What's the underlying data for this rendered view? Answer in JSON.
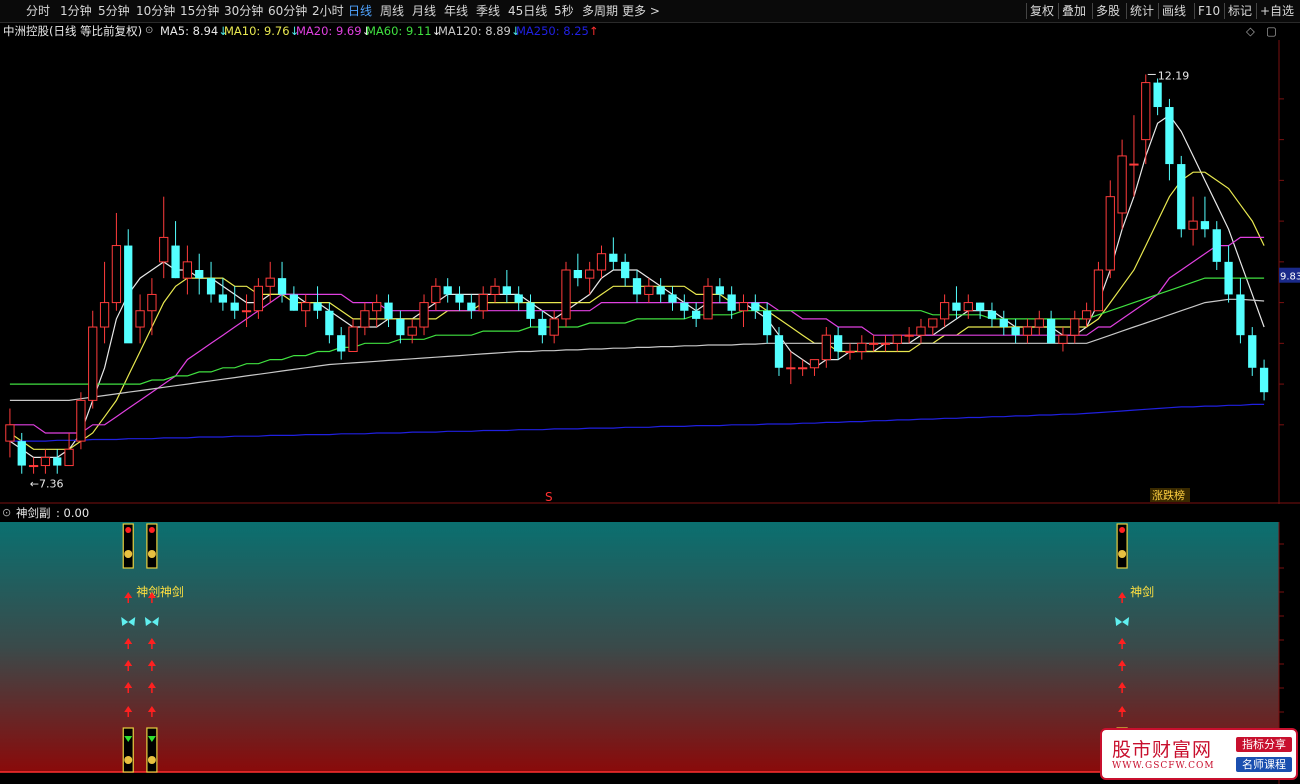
{
  "toolbar": {
    "periods": [
      "分时",
      "1分钟",
      "5分钟",
      "10分钟",
      "15分钟",
      "30分钟",
      "60分钟",
      "2小时",
      "日线",
      "周线",
      "月线",
      "年线",
      "季线",
      "45日线",
      "5秒",
      "多周期",
      "更多 >"
    ],
    "active": "日线",
    "tools": [
      "复权",
      "叠加",
      "多股",
      "统计",
      "画线",
      "F10",
      "标记",
      "+自选"
    ]
  },
  "info": {
    "title": "中洲控股(日线 等比前复权)",
    "ma": [
      {
        "label": "MA5: 8.94",
        "arrow": "↓",
        "color": "#e8e8e8",
        "arrow_color": "#4fe8e8"
      },
      {
        "label": "MA10: 9.76",
        "arrow": "↓",
        "color": "#e8e850",
        "arrow_color": "#4fe8e8"
      },
      {
        "label": "MA20: 9.69",
        "arrow": "↓",
        "color": "#e040e0",
        "arrow_color": "#e8e8e8"
      },
      {
        "label": "MA60: 9.11",
        "arrow": "↓",
        "color": "#40e040",
        "arrow_color": "#e8e8e8"
      },
      {
        "label": "MA120: 8.89",
        "arrow": "↓",
        "color": "#c8c8c8",
        "arrow_color": "#4fe8e8"
      },
      {
        "label": "MA250: 8.25",
        "arrow": "↑",
        "color": "#2020e0",
        "arrow_color": "#ff3030"
      }
    ]
  },
  "chart_data": {
    "type": "candlestick",
    "high_label": "12.19",
    "low_label": "7.36",
    "last_price": "9.83",
    "marker_s": "S",
    "badge": "涨跌榜",
    "up_color": "#ff3c3c",
    "down_color": "#54ffff",
    "ohlc": [
      [
        7.8,
        8.2,
        7.6,
        8.0
      ],
      [
        7.8,
        7.9,
        7.4,
        7.5
      ],
      [
        7.5,
        7.6,
        7.4,
        7.5
      ],
      [
        7.5,
        7.7,
        7.4,
        7.6
      ],
      [
        7.6,
        7.7,
        7.4,
        7.5
      ],
      [
        7.5,
        7.9,
        7.5,
        7.7
      ],
      [
        7.8,
        8.4,
        7.7,
        8.3
      ],
      [
        8.3,
        9.4,
        8.2,
        9.2
      ],
      [
        9.2,
        10.0,
        9.0,
        9.5
      ],
      [
        9.5,
        10.6,
        9.4,
        10.2
      ],
      [
        10.2,
        10.4,
        9.2,
        9.0
      ],
      [
        9.2,
        9.6,
        9.0,
        9.4
      ],
      [
        9.4,
        9.8,
        9.1,
        9.6
      ],
      [
        10.0,
        10.8,
        9.8,
        10.3
      ],
      [
        10.2,
        10.5,
        9.8,
        9.8
      ],
      [
        9.8,
        10.2,
        9.6,
        10.0
      ],
      [
        9.9,
        10.1,
        9.6,
        9.8
      ],
      [
        9.8,
        10.0,
        9.5,
        9.6
      ],
      [
        9.6,
        9.8,
        9.4,
        9.5
      ],
      [
        9.5,
        9.7,
        9.3,
        9.4
      ],
      [
        9.4,
        9.6,
        9.2,
        9.4
      ],
      [
        9.4,
        9.8,
        9.3,
        9.7
      ],
      [
        9.7,
        10.0,
        9.5,
        9.8
      ],
      [
        9.8,
        10.0,
        9.5,
        9.6
      ],
      [
        9.6,
        9.7,
        9.4,
        9.4
      ],
      [
        9.4,
        9.6,
        9.2,
        9.5
      ],
      [
        9.5,
        9.7,
        9.3,
        9.4
      ],
      [
        9.4,
        9.5,
        9.0,
        9.1
      ],
      [
        9.1,
        9.2,
        8.8,
        8.9
      ],
      [
        8.9,
        9.3,
        8.9,
        9.2
      ],
      [
        9.2,
        9.5,
        9.1,
        9.4
      ],
      [
        9.4,
        9.6,
        9.2,
        9.5
      ],
      [
        9.5,
        9.6,
        9.2,
        9.3
      ],
      [
        9.3,
        9.4,
        9.0,
        9.1
      ],
      [
        9.1,
        9.3,
        9.0,
        9.2
      ],
      [
        9.2,
        9.6,
        9.1,
        9.5
      ],
      [
        9.5,
        9.8,
        9.4,
        9.7
      ],
      [
        9.7,
        9.8,
        9.5,
        9.6
      ],
      [
        9.6,
        9.7,
        9.4,
        9.5
      ],
      [
        9.5,
        9.6,
        9.3,
        9.4
      ],
      [
        9.4,
        9.7,
        9.3,
        9.6
      ],
      [
        9.6,
        9.8,
        9.5,
        9.7
      ],
      [
        9.7,
        9.9,
        9.5,
        9.6
      ],
      [
        9.6,
        9.7,
        9.4,
        9.5
      ],
      [
        9.5,
        9.6,
        9.2,
        9.3
      ],
      [
        9.3,
        9.4,
        9.0,
        9.1
      ],
      [
        9.1,
        9.4,
        9.0,
        9.3
      ],
      [
        9.3,
        10.0,
        9.2,
        9.9
      ],
      [
        9.9,
        10.1,
        9.7,
        9.8
      ],
      [
        9.8,
        10.0,
        9.6,
        9.9
      ],
      [
        9.9,
        10.2,
        9.8,
        10.1
      ],
      [
        10.1,
        10.3,
        9.9,
        10.0
      ],
      [
        10.0,
        10.1,
        9.7,
        9.8
      ],
      [
        9.8,
        9.9,
        9.5,
        9.6
      ],
      [
        9.6,
        9.8,
        9.5,
        9.7
      ],
      [
        9.7,
        9.8,
        9.5,
        9.6
      ],
      [
        9.6,
        9.7,
        9.4,
        9.5
      ],
      [
        9.5,
        9.6,
        9.3,
        9.4
      ],
      [
        9.4,
        9.5,
        9.2,
        9.3
      ],
      [
        9.3,
        9.8,
        9.3,
        9.7
      ],
      [
        9.7,
        9.8,
        9.5,
        9.6
      ],
      [
        9.6,
        9.7,
        9.3,
        9.4
      ],
      [
        9.4,
        9.6,
        9.2,
        9.5
      ],
      [
        9.5,
        9.6,
        9.3,
        9.4
      ],
      [
        9.4,
        9.5,
        9.0,
        9.1
      ],
      [
        9.1,
        9.2,
        8.6,
        8.7
      ],
      [
        8.7,
        8.9,
        8.5,
        8.7
      ],
      [
        8.7,
        8.8,
        8.6,
        8.7
      ],
      [
        8.7,
        8.8,
        8.6,
        8.8
      ],
      [
        8.8,
        9.2,
        8.7,
        9.1
      ],
      [
        9.1,
        9.2,
        8.8,
        8.9
      ],
      [
        8.9,
        9.0,
        8.8,
        8.9
      ],
      [
        8.9,
        9.1,
        8.8,
        9.0
      ],
      [
        9.0,
        9.1,
        8.9,
        9.0
      ],
      [
        9.0,
        9.1,
        8.9,
        9.0
      ],
      [
        9.0,
        9.1,
        8.9,
        9.1
      ],
      [
        9.1,
        9.2,
        9.0,
        9.1
      ],
      [
        9.1,
        9.3,
        9.0,
        9.2
      ],
      [
        9.2,
        9.3,
        9.1,
        9.3
      ],
      [
        9.3,
        9.6,
        9.2,
        9.5
      ],
      [
        9.5,
        9.7,
        9.3,
        9.4
      ],
      [
        9.4,
        9.6,
        9.3,
        9.5
      ],
      [
        9.5,
        9.5,
        9.3,
        9.4
      ],
      [
        9.4,
        9.5,
        9.2,
        9.3
      ],
      [
        9.3,
        9.4,
        9.1,
        9.2
      ],
      [
        9.2,
        9.3,
        9.0,
        9.1
      ],
      [
        9.1,
        9.3,
        9.0,
        9.2
      ],
      [
        9.2,
        9.4,
        9.1,
        9.3
      ],
      [
        9.3,
        9.4,
        9.0,
        9.0
      ],
      [
        9.0,
        9.2,
        8.9,
        9.1
      ],
      [
        9.1,
        9.4,
        9.0,
        9.3
      ],
      [
        9.3,
        9.5,
        9.2,
        9.4
      ],
      [
        9.4,
        10.0,
        9.4,
        9.9
      ],
      [
        9.9,
        11.0,
        9.8,
        10.8
      ],
      [
        10.6,
        11.5,
        10.4,
        11.3
      ],
      [
        11.2,
        11.8,
        10.8,
        11.2
      ],
      [
        11.5,
        12.3,
        11.2,
        12.2
      ],
      [
        12.2,
        12.25,
        11.8,
        11.9
      ],
      [
        11.9,
        12.0,
        11.0,
        11.2
      ],
      [
        11.2,
        11.3,
        10.3,
        10.4
      ],
      [
        10.4,
        10.8,
        10.2,
        10.5
      ],
      [
        10.5,
        10.8,
        10.3,
        10.4
      ],
      [
        10.4,
        10.5,
        9.9,
        10.0
      ],
      [
        10.0,
        10.2,
        9.5,
        9.6
      ],
      [
        9.6,
        9.8,
        9.0,
        9.1
      ],
      [
        9.1,
        9.2,
        8.6,
        8.7
      ],
      [
        8.7,
        8.8,
        8.3,
        8.4
      ]
    ],
    "ma_lines": [
      {
        "name": "MA5",
        "color": "#e8e8e8",
        "values": [
          7.8,
          7.7,
          7.6,
          7.6,
          7.6,
          7.7,
          7.9,
          8.3,
          8.7,
          9.3,
          9.6,
          9.8,
          9.9,
          10.0,
          9.9,
          9.9,
          9.8,
          9.8,
          9.7,
          9.6,
          9.5,
          9.5,
          9.6,
          9.6,
          9.6,
          9.5,
          9.5,
          9.4,
          9.3,
          9.2,
          9.2,
          9.2,
          9.3,
          9.3,
          9.3,
          9.4,
          9.5,
          9.6,
          9.6,
          9.6,
          9.6,
          9.6,
          9.6,
          9.6,
          9.5,
          9.4,
          9.3,
          9.4,
          9.5,
          9.6,
          9.8,
          9.9,
          9.9,
          9.9,
          9.8,
          9.7,
          9.6,
          9.5,
          9.4,
          9.5,
          9.5,
          9.5,
          9.5,
          9.4,
          9.3,
          9.1,
          8.9,
          8.8,
          8.7,
          8.8,
          8.8,
          8.9,
          8.9,
          8.9,
          9.0,
          9.0,
          9.0,
          9.1,
          9.1,
          9.2,
          9.3,
          9.4,
          9.4,
          9.4,
          9.3,
          9.2,
          9.2,
          9.2,
          9.2,
          9.1,
          9.1,
          9.2,
          9.5,
          9.9,
          10.4,
          10.8,
          11.3,
          11.7,
          11.8,
          11.6,
          11.3,
          11.0,
          10.7,
          10.4,
          10.0,
          9.6,
          9.2
        ]
      },
      {
        "name": "MA10",
        "color": "#e8e850",
        "values": [
          7.9,
          7.8,
          7.7,
          7.7,
          7.7,
          7.7,
          7.8,
          7.9,
          8.1,
          8.3,
          8.6,
          8.9,
          9.2,
          9.5,
          9.7,
          9.8,
          9.8,
          9.8,
          9.8,
          9.7,
          9.7,
          9.6,
          9.6,
          9.6,
          9.5,
          9.5,
          9.5,
          9.5,
          9.4,
          9.3,
          9.3,
          9.3,
          9.3,
          9.3,
          9.3,
          9.3,
          9.3,
          9.4,
          9.4,
          9.4,
          9.5,
          9.5,
          9.5,
          9.5,
          9.5,
          9.5,
          9.5,
          9.5,
          9.5,
          9.5,
          9.6,
          9.7,
          9.7,
          9.7,
          9.7,
          9.7,
          9.7,
          9.7,
          9.6,
          9.6,
          9.6,
          9.5,
          9.5,
          9.5,
          9.4,
          9.3,
          9.2,
          9.1,
          9.0,
          9.0,
          8.9,
          8.9,
          8.9,
          8.9,
          8.9,
          8.9,
          8.9,
          9.0,
          9.0,
          9.1,
          9.1,
          9.2,
          9.2,
          9.2,
          9.2,
          9.2,
          9.2,
          9.2,
          9.2,
          9.2,
          9.2,
          9.2,
          9.3,
          9.5,
          9.7,
          9.9,
          10.2,
          10.5,
          10.8,
          11.0,
          11.1,
          11.1,
          11.0,
          10.9,
          10.7,
          10.5,
          10.2
        ]
      },
      {
        "name": "MA20",
        "color": "#e040e0",
        "values": [
          8.0,
          8.0,
          8.0,
          7.9,
          7.9,
          7.9,
          7.9,
          8.0,
          8.0,
          8.1,
          8.2,
          8.3,
          8.4,
          8.5,
          8.6,
          8.8,
          8.9,
          9.0,
          9.1,
          9.2,
          9.3,
          9.4,
          9.5,
          9.6,
          9.6,
          9.6,
          9.6,
          9.6,
          9.6,
          9.5,
          9.5,
          9.5,
          9.4,
          9.4,
          9.4,
          9.4,
          9.4,
          9.4,
          9.4,
          9.4,
          9.4,
          9.4,
          9.4,
          9.4,
          9.4,
          9.4,
          9.4,
          9.4,
          9.4,
          9.4,
          9.5,
          9.5,
          9.5,
          9.5,
          9.5,
          9.5,
          9.5,
          9.5,
          9.5,
          9.5,
          9.5,
          9.5,
          9.5,
          9.5,
          9.5,
          9.4,
          9.4,
          9.3,
          9.3,
          9.3,
          9.2,
          9.2,
          9.2,
          9.1,
          9.1,
          9.1,
          9.1,
          9.1,
          9.1,
          9.1,
          9.1,
          9.1,
          9.1,
          9.1,
          9.1,
          9.1,
          9.1,
          9.1,
          9.1,
          9.1,
          9.1,
          9.1,
          9.2,
          9.2,
          9.3,
          9.4,
          9.5,
          9.6,
          9.8,
          9.9,
          10.0,
          10.1,
          10.2,
          10.2,
          10.3,
          10.3,
          10.3
        ]
      },
      {
        "name": "MA60",
        "color": "#40e040",
        "values": [
          8.5,
          8.5,
          8.5,
          8.5,
          8.5,
          8.5,
          8.5,
          8.5,
          8.5,
          8.5,
          8.5,
          8.5,
          8.55,
          8.55,
          8.6,
          8.6,
          8.65,
          8.65,
          8.7,
          8.7,
          8.75,
          8.75,
          8.8,
          8.8,
          8.85,
          8.85,
          8.9,
          8.9,
          8.95,
          8.95,
          9.0,
          9.0,
          9.0,
          9.05,
          9.05,
          9.05,
          9.1,
          9.1,
          9.1,
          9.1,
          9.15,
          9.15,
          9.15,
          9.15,
          9.2,
          9.2,
          9.2,
          9.2,
          9.2,
          9.25,
          9.25,
          9.25,
          9.25,
          9.3,
          9.3,
          9.3,
          9.3,
          9.3,
          9.35,
          9.35,
          9.35,
          9.35,
          9.4,
          9.4,
          9.4,
          9.4,
          9.4,
          9.4,
          9.4,
          9.4,
          9.4,
          9.4,
          9.4,
          9.4,
          9.4,
          9.4,
          9.4,
          9.4,
          9.35,
          9.35,
          9.35,
          9.35,
          9.35,
          9.3,
          9.3,
          9.3,
          9.3,
          9.3,
          9.3,
          9.3,
          9.3,
          9.3,
          9.35,
          9.4,
          9.45,
          9.5,
          9.55,
          9.6,
          9.65,
          9.7,
          9.75,
          9.8,
          9.8,
          9.8,
          9.8,
          9.8,
          9.8
        ]
      },
      {
        "name": "MA120",
        "color": "#c8c8c8",
        "values": [
          8.3,
          8.3,
          8.3,
          8.3,
          8.3,
          8.3,
          8.32,
          8.34,
          8.36,
          8.38,
          8.4,
          8.42,
          8.44,
          8.46,
          8.48,
          8.5,
          8.52,
          8.54,
          8.56,
          8.58,
          8.6,
          8.62,
          8.64,
          8.66,
          8.68,
          8.7,
          8.72,
          8.74,
          8.75,
          8.76,
          8.77,
          8.78,
          8.79,
          8.8,
          8.81,
          8.82,
          8.83,
          8.84,
          8.85,
          8.86,
          8.87,
          8.88,
          8.89,
          8.9,
          8.9,
          8.91,
          8.91,
          8.92,
          8.92,
          8.93,
          8.93,
          8.94,
          8.94,
          8.95,
          8.95,
          8.96,
          8.96,
          8.97,
          8.97,
          8.98,
          8.98,
          8.98,
          8.99,
          8.99,
          9.0,
          9.0,
          9.0,
          9.0,
          9.0,
          9.0,
          9.0,
          9.0,
          9.0,
          9.0,
          9.0,
          9.0,
          9.0,
          9.0,
          9.0,
          9.0,
          9.0,
          9.0,
          9.0,
          9.0,
          9.0,
          9.0,
          9.0,
          9.0,
          9.0,
          9.0,
          9.0,
          9.0,
          9.05,
          9.1,
          9.15,
          9.2,
          9.25,
          9.3,
          9.35,
          9.4,
          9.45,
          9.5,
          9.52,
          9.54,
          9.54,
          9.53,
          9.52
        ]
      },
      {
        "name": "MA250",
        "color": "#2020e0",
        "values": [
          7.8,
          7.8,
          7.8,
          7.8,
          7.81,
          7.81,
          7.81,
          7.82,
          7.82,
          7.82,
          7.83,
          7.83,
          7.83,
          7.84,
          7.84,
          7.84,
          7.85,
          7.85,
          7.85,
          7.86,
          7.86,
          7.86,
          7.87,
          7.87,
          7.87,
          7.88,
          7.88,
          7.88,
          7.89,
          7.89,
          7.89,
          7.9,
          7.9,
          7.9,
          7.91,
          7.91,
          7.91,
          7.92,
          7.92,
          7.92,
          7.93,
          7.93,
          7.93,
          7.94,
          7.94,
          7.94,
          7.95,
          7.95,
          7.95,
          7.96,
          7.96,
          7.96,
          7.97,
          7.97,
          7.97,
          7.98,
          7.98,
          7.98,
          7.99,
          7.99,
          7.99,
          8.0,
          8.0,
          8.0,
          8.01,
          8.01,
          8.01,
          8.02,
          8.02,
          8.03,
          8.03,
          8.04,
          8.04,
          8.05,
          8.05,
          8.06,
          8.06,
          8.07,
          8.07,
          8.08,
          8.08,
          8.09,
          8.09,
          8.1,
          8.1,
          8.11,
          8.11,
          8.12,
          8.12,
          8.13,
          8.13,
          8.14,
          8.15,
          8.16,
          8.17,
          8.18,
          8.19,
          8.2,
          8.21,
          8.22,
          8.22,
          8.23,
          8.23,
          8.24,
          8.24,
          8.25,
          8.25
        ]
      }
    ],
    "ylim": [
      7.2,
      12.6
    ]
  },
  "sub": {
    "title": "神剑副",
    "value": ": 0.00",
    "signal_label": "神剑",
    "signals": [
      10,
      12,
      94
    ]
  },
  "watermark": {
    "title": "股市财富网",
    "url": "WWW.GSCFW.COM",
    "tag1": "指标分享",
    "tag2": "名师课程"
  }
}
